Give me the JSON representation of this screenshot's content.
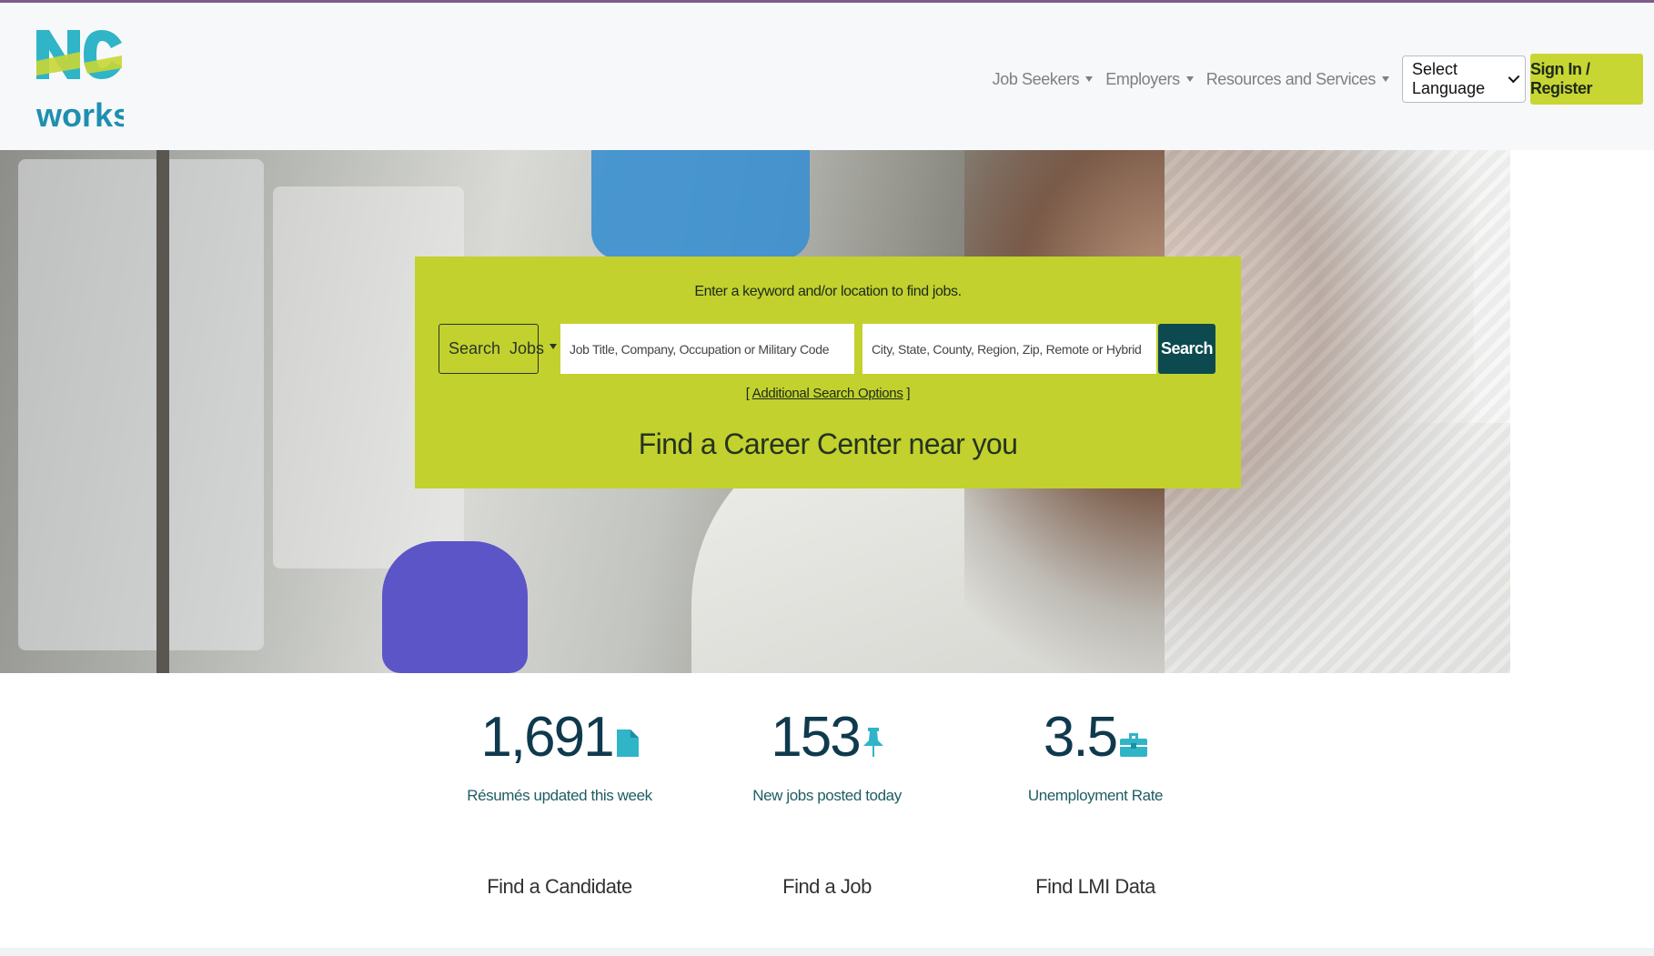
{
  "header": {
    "logo_text_top": "NC",
    "logo_text_bottom": "works",
    "nav": {
      "job_seekers": "Job Seekers",
      "employers": "Employers",
      "resources": "Resources and Services"
    },
    "language_select": "Select Language",
    "sign_in": "Sign In / Register"
  },
  "hero": {
    "hint": "Enter a keyword and/or location to find jobs.",
    "search_type": "Search  Jobs",
    "keyword_placeholder": "Job Title, Company, Occupation or Military Code",
    "location_placeholder": "City, State, County, Region, Zip, Remote or Hybrid",
    "search_button": "Search",
    "advanced_open": "[ ",
    "advanced_link": "Additional Search Options",
    "advanced_close": " ]",
    "career_center": "Find a Career Center near you"
  },
  "stats": [
    {
      "value": "1,691",
      "label": "Résumés updated this week",
      "link": "Find a Candidate",
      "icon": "document-icon"
    },
    {
      "value": "153",
      "label": "New jobs posted today",
      "link": "Find a Job",
      "icon": "pushpin-icon"
    },
    {
      "value": "3.5",
      "label": "Unemployment Rate",
      "link": "Find LMI Data",
      "icon": "briefcase-icon"
    }
  ],
  "colors": {
    "accent_green": "#c2d12e",
    "search_button": "#0c4a4f",
    "stat_value": "#0f3a4e",
    "stat_label": "#1f5d63",
    "top_border": "#7b5c8e"
  }
}
